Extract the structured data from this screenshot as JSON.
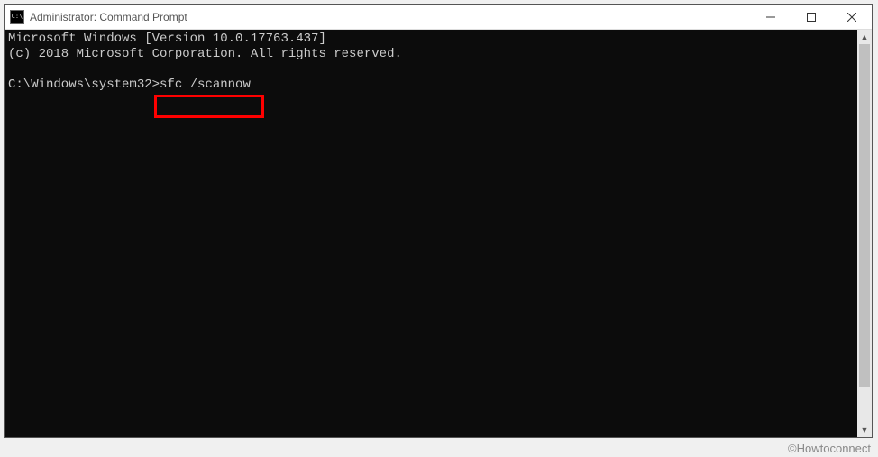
{
  "window": {
    "title": "Administrator: Command Prompt"
  },
  "terminal": {
    "line1": "Microsoft Windows [Version 10.0.17763.437]",
    "line2": "(c) 2018 Microsoft Corporation. All rights reserved.",
    "blank": "",
    "prompt": "C:\\Windows\\system32>",
    "command": "sfc /scannow"
  },
  "watermark": "©Howtoconnect"
}
